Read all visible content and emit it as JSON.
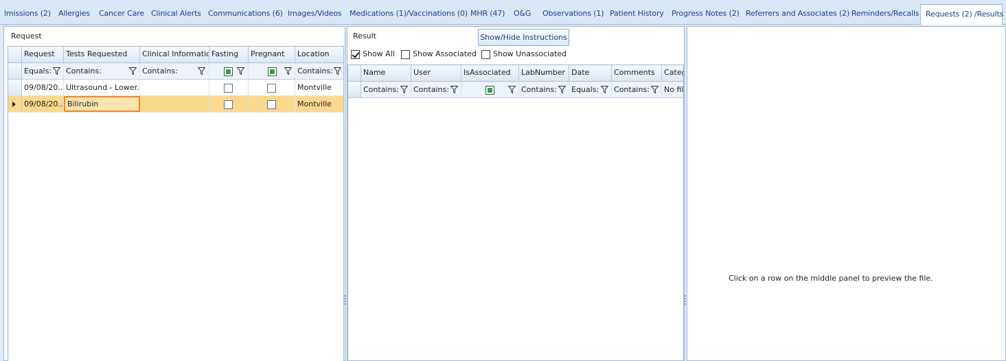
{
  "tabs": [
    {
      "label": "lmissions (2)"
    },
    {
      "label": "Allergies"
    },
    {
      "label": "Cancer Care"
    },
    {
      "label": "Clinical Alerts"
    },
    {
      "label": "Communications (6)"
    },
    {
      "label": "Images/Videos"
    },
    {
      "label": "Medications (1)/Vaccinations (0)"
    },
    {
      "label": "MHR (47)"
    },
    {
      "label": "O&G"
    },
    {
      "label": "Observations (1)"
    },
    {
      "label": "Patient History"
    },
    {
      "label": "Progress Notes (2)"
    },
    {
      "label": "Referrers and Associates (2)"
    },
    {
      "label": "Reminders/Recalls"
    },
    {
      "label": "Requests (2) /Results"
    }
  ],
  "request_panel": {
    "title": "Request",
    "columns": [
      "Request",
      "Tests Requested",
      "Clinical Information",
      "Fasting",
      "Pregnant",
      "Location"
    ],
    "filters": [
      "Equals:",
      "Contains:",
      "Contains:",
      "",
      "",
      "Contains:"
    ],
    "rows": [
      {
        "request": "09/08/20...",
        "tests": "Ultrasound - Lower...",
        "clinical": "",
        "location": "Montville"
      },
      {
        "request": "09/08/20...",
        "tests": "Bilirubin",
        "clinical": "",
        "location": "Montville"
      }
    ]
  },
  "result_panel": {
    "title": "Result",
    "toggle_button": "Show/Hide Instructions",
    "show_all": "Show All",
    "show_associated": "Show Associated",
    "show_unassociated": "Show Unassociated",
    "columns": [
      "Name",
      "User",
      "IsAssociated",
      "LabNumber",
      "Date",
      "Comments",
      "Categ"
    ],
    "filters": [
      "Contains:",
      "Contains:",
      "",
      "Contains:",
      "Equals:",
      "Contains:",
      "No filt"
    ]
  },
  "preview_panel": {
    "message": "Click on a row on the middle panel to preview the file."
  },
  "colors": {
    "tab_text": "#15428b",
    "selected_row": "#fbd88e",
    "focus_border": "#f08a2a",
    "checkbox_fill": "#35a043"
  }
}
